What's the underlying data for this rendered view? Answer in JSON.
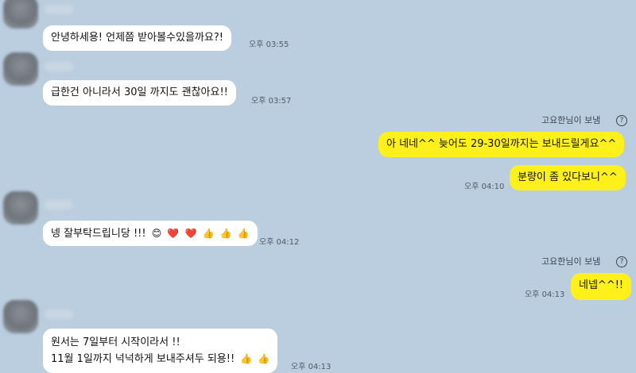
{
  "messages": [
    {
      "text": "안녕하세용! 언제쯤 받아볼수있을까요?!",
      "time": "오후 03:55"
    },
    {
      "text": "급한건 아니라서 30일 까지도 괜찮아요!!",
      "time": "오후 03:57"
    },
    {
      "sender_label": "고요한님이 보냄",
      "lines": [
        "아 네네^^ 늦어도 29-30일까지는 보내드릴게요^^",
        "분량이 좀 있다보니^^"
      ],
      "time": "오후 04:10"
    },
    {
      "text": "넹 잘부탁드립니당 !!!",
      "emojis": [
        "😊",
        "❤️",
        "❤️",
        "👍",
        "👍",
        "👍"
      ],
      "time": "오후 04:12"
    },
    {
      "sender_label": "고요한님이 보냄",
      "text": "네넵^^!!",
      "time": "오후 04:13"
    },
    {
      "lines": [
        "원서는 7일부터 시작이라서 !!",
        "11월 1일까지 넉넉하게 보내주셔두 되용!!"
      ],
      "emojis": [
        "👍",
        "👍"
      ],
      "time": "오후 04:13"
    }
  ],
  "help_icon_glyph": "?"
}
